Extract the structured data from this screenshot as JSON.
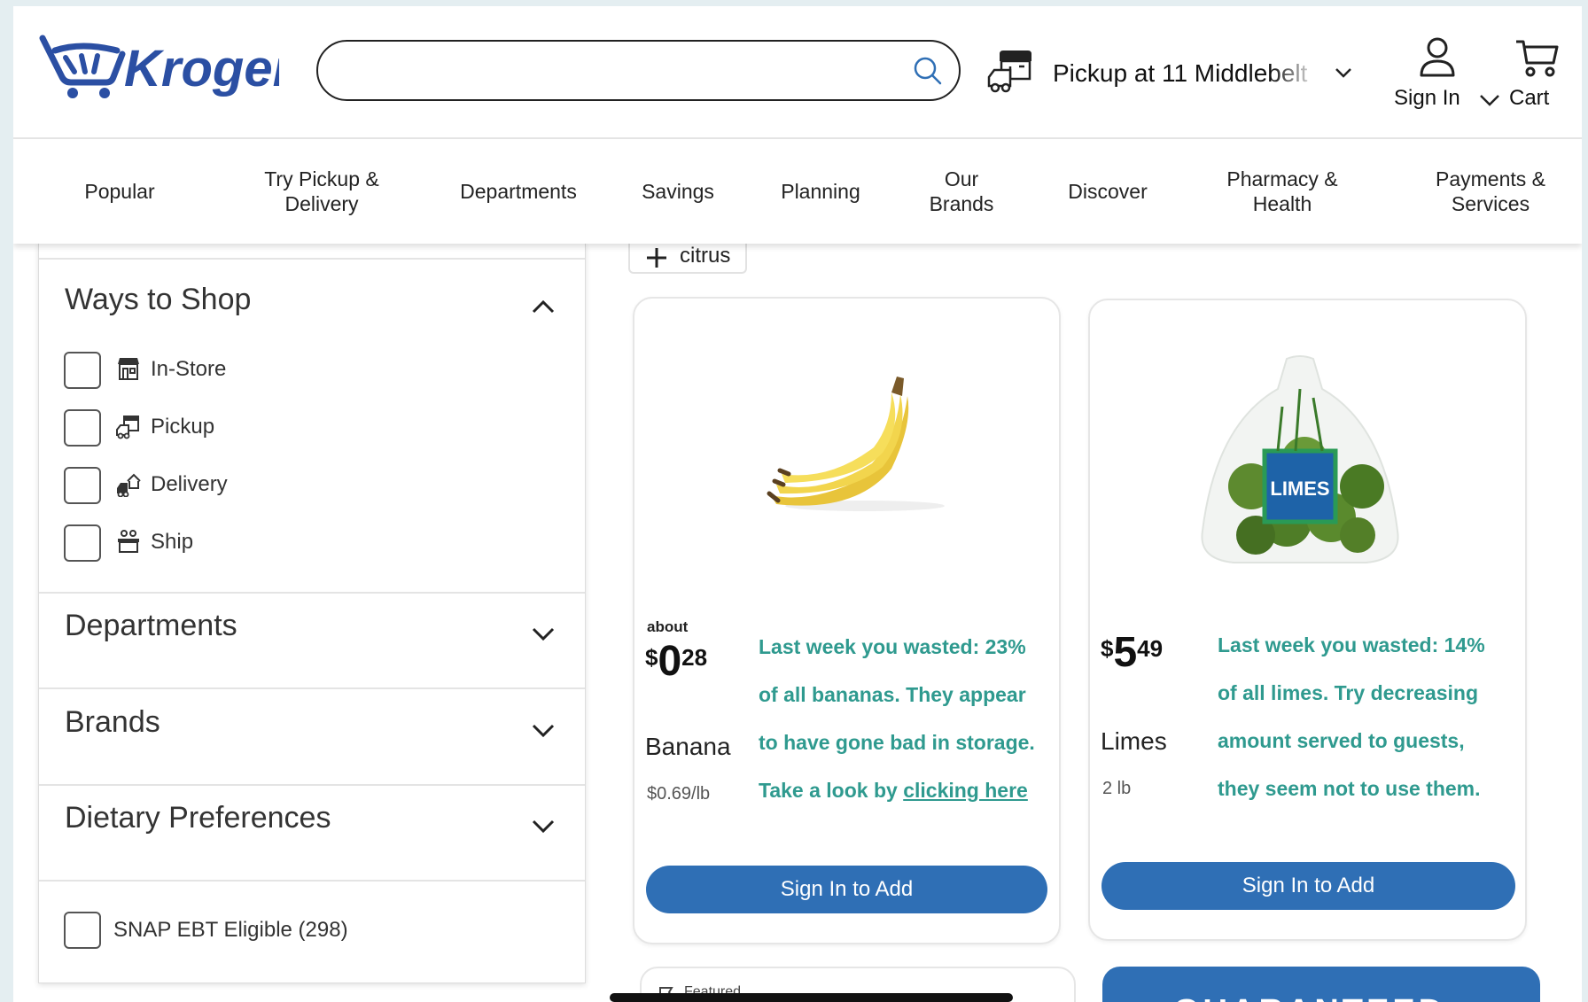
{
  "brand": {
    "name": "Kroger",
    "color": "#2b4fa3"
  },
  "header": {
    "search": {
      "value": "",
      "placeholder": ""
    },
    "pickup_label": "Pickup at 11 Middlebelt",
    "sign_in_label": "Sign In",
    "cart_label": "Cart"
  },
  "nav": {
    "items": [
      {
        "label": "Popular"
      },
      {
        "label": "Try Pickup &\nDelivery"
      },
      {
        "label": "Departments"
      },
      {
        "label": "Savings"
      },
      {
        "label": "Planning"
      },
      {
        "label": "Our\nBrands"
      },
      {
        "label": "Discover"
      },
      {
        "label": "Pharmacy &\nHealth"
      },
      {
        "label": "Payments &\nServices"
      }
    ]
  },
  "filters": {
    "ways_to_shop": {
      "title": "Ways to Shop",
      "options": [
        {
          "label": "In-Store",
          "icon": "store-icon"
        },
        {
          "label": "Pickup",
          "icon": "pickup-truck-icon"
        },
        {
          "label": "Delivery",
          "icon": "delivery-icon"
        },
        {
          "label": "Ship",
          "icon": "ship-box-icon"
        }
      ]
    },
    "departments_title": "Departments",
    "brands_title": "Brands",
    "dietary_title": "Dietary Preferences",
    "snap_label": "SNAP EBT Eligible (298)"
  },
  "chip": {
    "label": "citrus"
  },
  "products": [
    {
      "about": "about",
      "price_currency": "$",
      "price_dollars": "0",
      "price_cents": "28",
      "name": "Banana",
      "sub": "$0.69/lb",
      "tip": [
        "Last week you wasted: 23%",
        "of all bananas. They appear",
        "to have gone bad in storage.",
        "Take a look by "
      ],
      "tip_link": "clicking here",
      "button": "Sign In to Add"
    },
    {
      "price_currency": "$",
      "price_dollars": "5",
      "price_cents": "49",
      "name": "Limes",
      "sub": "2 lb",
      "tip": [
        "Last week you wasted: 14%",
        "of all limes. Try decreasing",
        "amount served to guests,",
        "they seem not to use them."
      ],
      "button": "Sign In to Add",
      "package_text": "LIMES"
    }
  ],
  "bottom": {
    "featured_label": "Featured",
    "guarantee_label": "GUARANTEED"
  },
  "colors": {
    "accent": "#2f6fb5",
    "tip": "#2f9a8f"
  }
}
